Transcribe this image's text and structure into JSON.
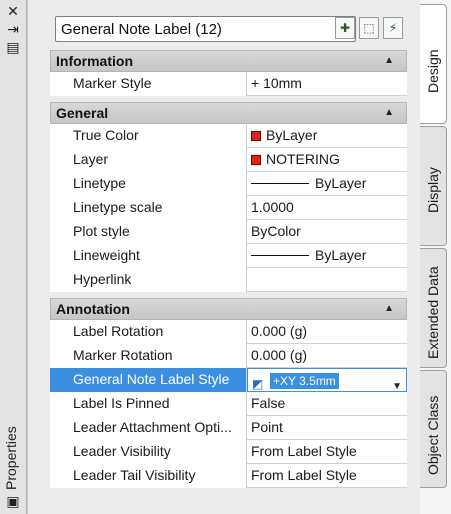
{
  "palette": {
    "title": "Properties"
  },
  "selector": {
    "value": "General Note Label (12)"
  },
  "toolbar_icons": [
    "toggle-pickadd-icon",
    "select-objects-icon",
    "quick-select-icon"
  ],
  "tabs": [
    "Design",
    "Display",
    "Extended Data",
    "Object Class"
  ],
  "sections": {
    "information": {
      "title": "Information",
      "rows": [
        {
          "key": "Marker Style",
          "value": "+ 10mm"
        }
      ]
    },
    "general": {
      "title": "General",
      "rows": [
        {
          "key": "True Color",
          "value": "ByLayer"
        },
        {
          "key": "Layer",
          "value": "NOTERING"
        },
        {
          "key": "Linetype",
          "value": "ByLayer"
        },
        {
          "key": "Linetype scale",
          "value": "1.0000"
        },
        {
          "key": "Plot style",
          "value": "ByColor"
        },
        {
          "key": "Lineweight",
          "value": "ByLayer"
        },
        {
          "key": "Hyperlink",
          "value": ""
        }
      ]
    },
    "annotation": {
      "title": "Annotation",
      "rows": [
        {
          "key": "Label Rotation",
          "value": "0.000 (g)"
        },
        {
          "key": "Marker Rotation",
          "value": "0.000 (g)"
        },
        {
          "key": "General Note Label Style",
          "value": "+XY 3.5mm"
        },
        {
          "key": "Label Is Pinned",
          "value": "False"
        },
        {
          "key": "Leader Attachment Opti...",
          "value": "Point"
        },
        {
          "key": "Leader Visibility",
          "value": "From Label Style"
        },
        {
          "key": "Leader Tail Visibility",
          "value": "From Label Style"
        }
      ]
    }
  },
  "colors": {
    "accent": "#3b8fe0",
    "swatch": "#e02020"
  }
}
